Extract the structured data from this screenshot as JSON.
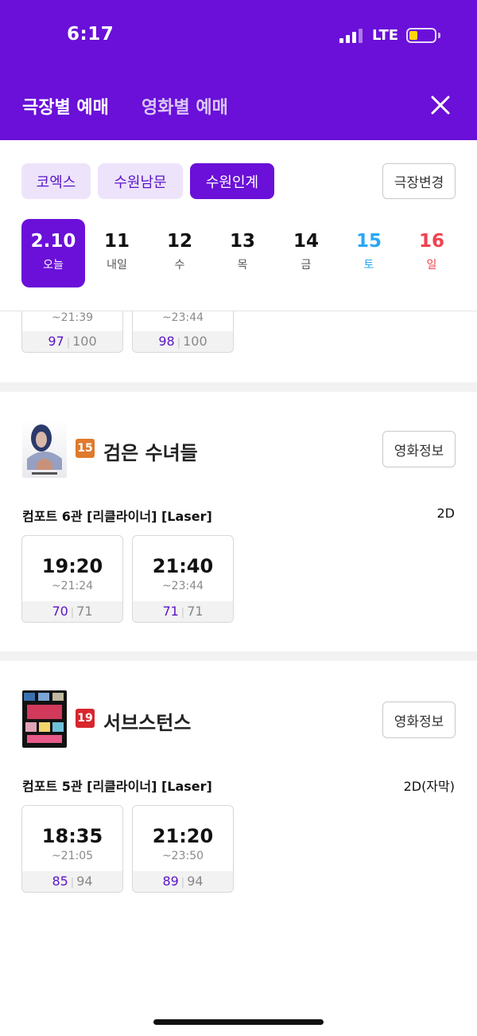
{
  "status_bar": {
    "time": "6:17",
    "network": "LTE"
  },
  "header": {
    "tab_theater": "극장별 예매",
    "tab_movie": "영화별 예매"
  },
  "theaters": {
    "chips": [
      "코엑스",
      "수원남문",
      "수원인계"
    ],
    "selected": "수원인계",
    "change_label": "극장변경"
  },
  "dates": [
    {
      "num": "2.10",
      "day": "오늘"
    },
    {
      "num": "11",
      "day": "내일"
    },
    {
      "num": "12",
      "day": "수"
    },
    {
      "num": "13",
      "day": "목"
    },
    {
      "num": "14",
      "day": "금"
    },
    {
      "num": "15",
      "day": "토"
    },
    {
      "num": "16",
      "day": "일"
    }
  ],
  "prev_movie": {
    "showtimes": [
      {
        "end": "~21:39",
        "available": "97",
        "total": "100"
      },
      {
        "end": "~23:44",
        "available": "98",
        "total": "100"
      }
    ]
  },
  "movies": [
    {
      "rating": "15",
      "title": "검은 수녀들",
      "info_label": "영화정보",
      "hall": "컴포트 6관 [리클라이너] [Laser]",
      "format": "2D",
      "showtimes": [
        {
          "start": "19:20",
          "end": "~21:24",
          "available": "70",
          "total": "71"
        },
        {
          "start": "21:40",
          "end": "~23:44",
          "available": "71",
          "total": "71"
        }
      ]
    },
    {
      "rating": "19",
      "title": "서브스턴스",
      "info_label": "영화정보",
      "hall": "컴포트 5관 [리클라이너] [Laser]",
      "format": "2D(자막)",
      "showtimes": [
        {
          "start": "18:35",
          "end": "~21:05",
          "available": "85",
          "total": "94"
        },
        {
          "start": "21:20",
          "end": "~23:50",
          "available": "89",
          "total": "94"
        }
      ]
    }
  ],
  "colors": {
    "brand": "#6a10d8",
    "rating_15": "#e07a2c",
    "rating_19": "#d9262e",
    "saturday": "#2aa8f5",
    "sunday": "#f0424f"
  },
  "icons": {
    "close": "close-icon",
    "signal": "signal-icon",
    "battery": "battery-icon"
  }
}
